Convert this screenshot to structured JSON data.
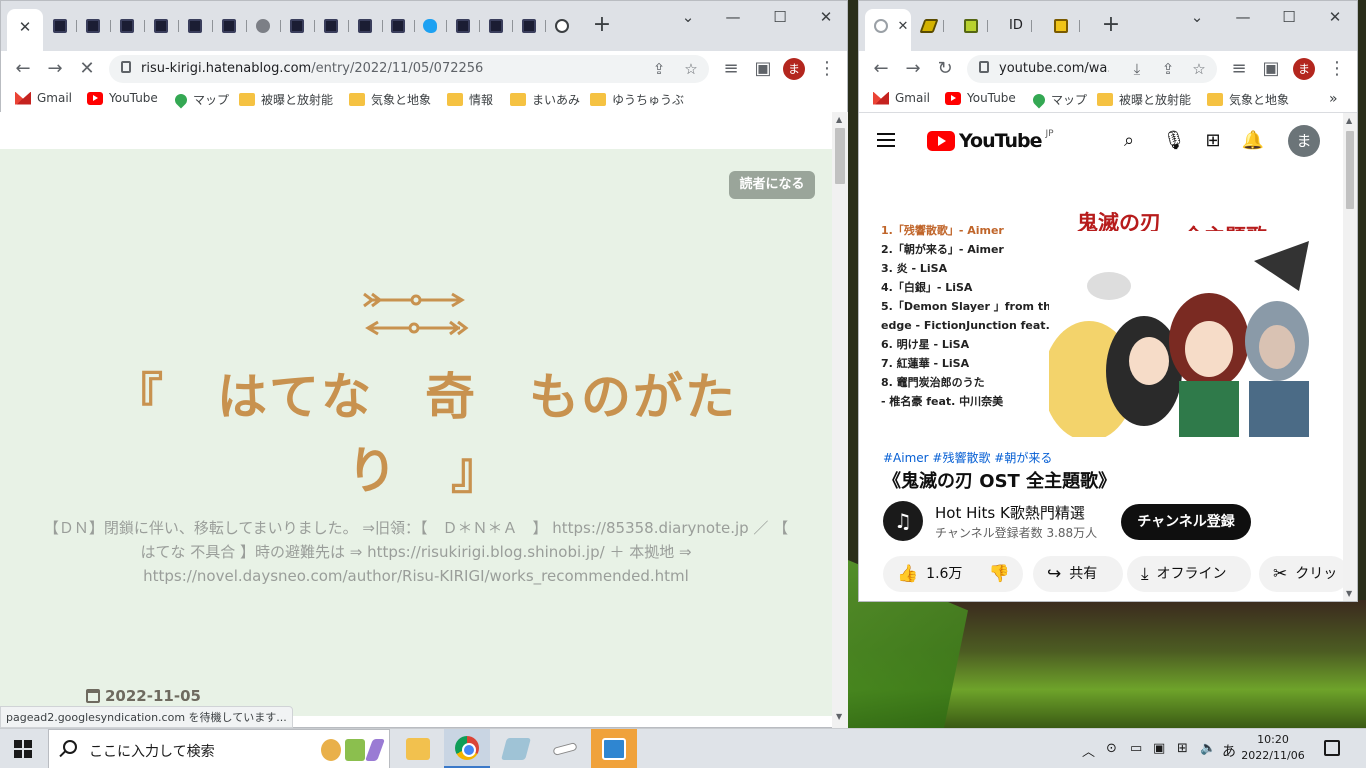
{
  "left": {
    "tab_active_close": "✕",
    "new_tab": "+",
    "url_host": "risu-kirigi.hatenablog.com",
    "url_path": "/entry/2022/11/05/072256",
    "reader_button": "読者になる",
    "blog_title": "『　はてな　奇　ものがたり　』",
    "blog_desc": "【ＤＮ】閉鎖に伴い、移転してまいりました。 ⇒旧領：【　Ｄ＊Ｎ＊Ａ　】 https://85358.diarynote.jp ／ 【 はてな 不具合 】時の避難先は ⇒ https://risukirigi.blog.shinobi.jp/ ＋ 本拠地 ⇒ https://novel.daysneo.com/author/Risu-KIRIGI/works_recommended.html",
    "post_date": "2022-11-05",
    "status": "pagead2.googlesyndication.com を待機しています..."
  },
  "bookmarks_left": [
    "Gmail",
    "YouTube",
    "マップ",
    "被曝と放射能",
    "気象と地象",
    "情報",
    "まいあみ",
    "ゆうちゅうぶ"
  ],
  "bookmarks_right": [
    "Gmail",
    "YouTube",
    "マップ",
    "被曝と放射能",
    "気象と地象"
  ],
  "right": {
    "tab_close": "✕",
    "tab3_text": "ID",
    "url": "youtube.com/wa...",
    "avatar": "ま",
    "yt_word": "YouTube",
    "yt_region": "JP",
    "yt_avatar": "ま",
    "thumb_title1": "鬼滅の刃",
    "thumb_title2": "全主題歌",
    "thumb_list": [
      "1.「残響散歌」- Aimer",
      "2.「朝が来る」- Aimer",
      "3.  炎 - LiSA",
      "4.「白銀」- LiSA",
      "5.「Demon Slayer 」from the",
      "    edge - FictionJunction feat.LiSA",
      "6.  明け星 - LiSA",
      "7.  紅蓮華 - LiSA",
      "8.  竈門炭治郎のうた",
      "   - 椎名豪 feat. 中川奈美"
    ],
    "tags": "#Aimer #残響散歌 #朝が来る",
    "video_title": "《鬼滅の刃 OST 全主題歌》",
    "channel_name": "Hot Hits K歌熱門精選",
    "channel_subs": "チャンネル登録者数 3.88万人",
    "subscribe": "チャンネル登録",
    "likes": "1.6万",
    "share": "共有",
    "offline": "オフライン",
    "clip": "クリッ"
  },
  "taskbar": {
    "search_placeholder": "ここに入力して検索",
    "time": "10:20",
    "date": "2022/11/06",
    "ime": "あ"
  }
}
